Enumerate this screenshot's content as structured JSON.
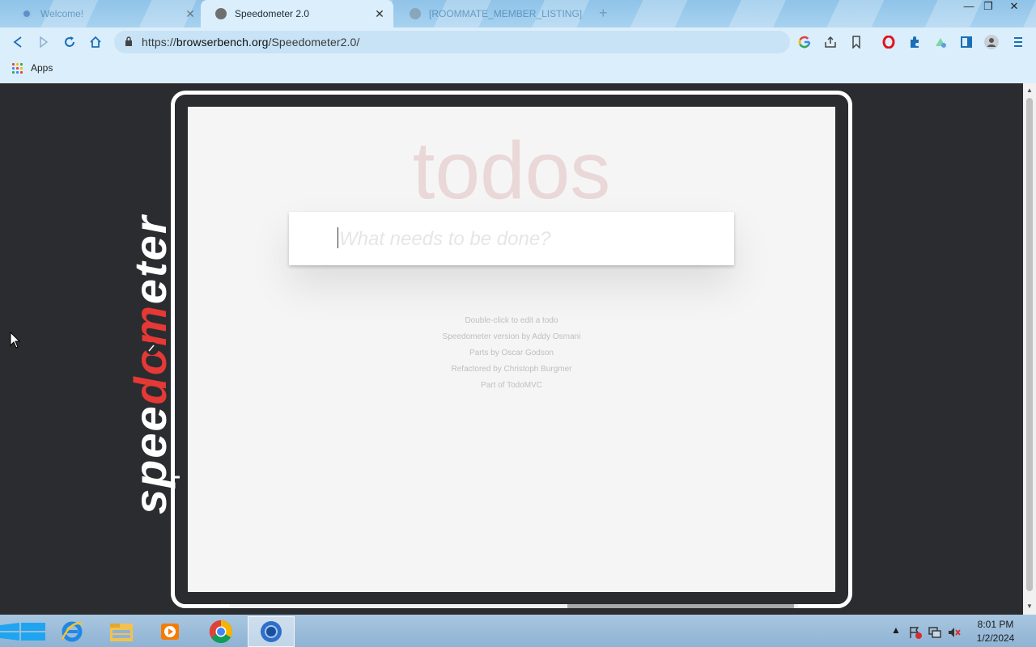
{
  "browser": {
    "tabs": [
      {
        "title": "Welcome!",
        "state": "inactive"
      },
      {
        "title": "Speedometer 2.0",
        "state": "active"
      },
      {
        "title": "[ROOMMATE_MEMBER_LISTING]",
        "state": "inactive"
      }
    ],
    "close_glyph": "✕",
    "new_tab_glyph": "+",
    "window_controls": {
      "minimize": "—",
      "restore": "❐",
      "close": "✕"
    },
    "address": {
      "scheme": "https://",
      "host": "browserbench.org",
      "path": "/Speedometer2.0/"
    },
    "bookmarks": {
      "apps_label": "Apps"
    },
    "icons": [
      "back-icon",
      "forward-icon",
      "reload-icon",
      "home-icon",
      "lock-icon",
      "google-icon",
      "share-icon",
      "bookmark-icon",
      "opera-icon",
      "extensions-icon",
      "profile-icon",
      "menu-icon"
    ]
  },
  "page": {
    "logo_text": "speedometer",
    "todo": {
      "title": "todos",
      "placeholder": "What needs to be done?",
      "info": [
        "Double-click to edit a todo",
        "Speedometer version by Addy Osmani",
        "Parts by Oscar Godson",
        "Refactored by Christoph Burgmer",
        "Part of TodoMVC"
      ]
    }
  },
  "taskbar": {
    "apps": [
      "internet-explorer",
      "file-explorer",
      "media-player",
      "chrome",
      "chromium"
    ],
    "active_app": "chromium",
    "clock": {
      "time": "8:01 PM",
      "date": "1/2/2024"
    }
  },
  "colors": {
    "accent_red": "#e53935",
    "page_bg": "#2a2c30",
    "chrome_blue": "#1a6fb8"
  }
}
